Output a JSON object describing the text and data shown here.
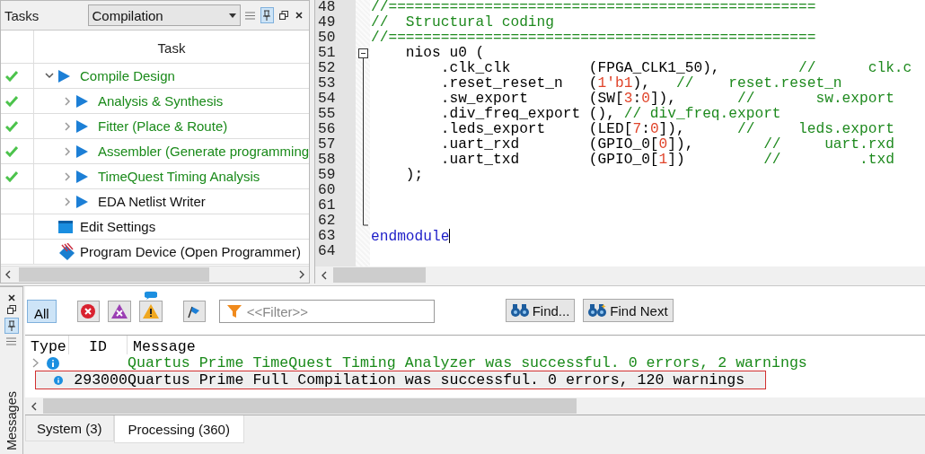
{
  "tasks_panel": {
    "title": "Tasks",
    "flow": "Compilation",
    "column_header": "Task",
    "items": [
      {
        "label": "Compile Design",
        "kind": "run",
        "done": true,
        "expanded": true,
        "children": [
          {
            "label": "Analysis & Synthesis",
            "kind": "run",
            "done": true,
            "expanded": false
          },
          {
            "label": "Fitter (Place & Route)",
            "kind": "run",
            "done": true,
            "expanded": false
          },
          {
            "label": "Assembler (Generate programming",
            "kind": "run",
            "done": true,
            "expanded": false
          },
          {
            "label": "TimeQuest Timing Analysis",
            "kind": "run",
            "done": true,
            "expanded": false
          },
          {
            "label": "EDA Netlist Writer",
            "kind": "run",
            "done": false,
            "expanded": false
          }
        ]
      },
      {
        "label": "Edit Settings",
        "kind": "settings",
        "done": false
      },
      {
        "label": "Program Device (Open Programmer)",
        "kind": "program",
        "done": false
      }
    ]
  },
  "editor": {
    "lines": [
      {
        "number": "48",
        "segments": [
          {
            "kind": "comment",
            "text": "//================================================="
          }
        ]
      },
      {
        "number": "49",
        "segments": [
          {
            "kind": "comment",
            "text": "//  Structural coding"
          }
        ]
      },
      {
        "number": "50",
        "segments": [
          {
            "kind": "comment",
            "text": "//================================================="
          }
        ]
      },
      {
        "number": "51",
        "expanded": true,
        "segments": [
          {
            "kind": "code",
            "text": "    nios u0 ("
          }
        ],
        "children": [
          {
            "number": "52",
            "segments": [
              {
                "kind": "code",
                "text": "        .clk_clk         (FPGA_CLK1_50),         "
              },
              {
                "kind": "comment",
                "text": "//      clk.c"
              }
            ]
          },
          {
            "number": "53",
            "segments": [
              {
                "kind": "code",
                "text": "        .reset_reset_n   ("
              },
              {
                "kind": "number",
                "text": "1'b1"
              },
              {
                "kind": "code",
                "text": "),   "
              },
              {
                "kind": "comment",
                "text": "//    reset.reset_n"
              }
            ]
          },
          {
            "number": "54",
            "segments": [
              {
                "kind": "code",
                "text": "        .sw_export       (SW["
              },
              {
                "kind": "number",
                "text": "3"
              },
              {
                "kind": "code",
                "text": ":"
              },
              {
                "kind": "number",
                "text": "0"
              },
              {
                "kind": "code",
                "text": "]),       "
              },
              {
                "kind": "comment",
                "text": "//       sw.export"
              }
            ]
          },
          {
            "number": "55",
            "segments": [
              {
                "kind": "code",
                "text": "        .div_freq_export (), "
              },
              {
                "kind": "comment",
                "text": "// div_freq.export"
              }
            ]
          },
          {
            "number": "56",
            "segments": [
              {
                "kind": "code",
                "text": "        .leds_export     (LED["
              },
              {
                "kind": "number",
                "text": "7"
              },
              {
                "kind": "code",
                "text": ":"
              },
              {
                "kind": "number",
                "text": "0"
              },
              {
                "kind": "code",
                "text": "]),      "
              },
              {
                "kind": "comment",
                "text": "//     leds.export"
              }
            ]
          },
          {
            "number": "57",
            "segments": [
              {
                "kind": "code",
                "text": "        .uart_rxd        (GPIO_0["
              },
              {
                "kind": "number",
                "text": "0"
              },
              {
                "kind": "code",
                "text": "]),        "
              },
              {
                "kind": "comment",
                "text": "//     uart.rxd"
              }
            ]
          },
          {
            "number": "58",
            "segments": [
              {
                "kind": "code",
                "text": "        .uart_txd        (GPIO_0["
              },
              {
                "kind": "number",
                "text": "1"
              },
              {
                "kind": "code",
                "text": "])         "
              },
              {
                "kind": "comment",
                "text": "//         .txd"
              }
            ]
          },
          {
            "number": "59",
            "segments": [
              {
                "kind": "code",
                "text": "    );"
              }
            ]
          },
          {
            "number": "60"
          },
          {
            "number": "61"
          },
          {
            "number": "62"
          }
        ]
      },
      {
        "number": "63",
        "cursor": true,
        "segments": [
          {
            "kind": "keyword",
            "text": "endmodule"
          }
        ]
      },
      {
        "number": "64"
      }
    ]
  },
  "messages_panel": {
    "title": "Messages",
    "filters": [
      {
        "kind": "all",
        "label": "All",
        "selected": true
      },
      {
        "kind": "error",
        "selected": false
      },
      {
        "kind": "critical",
        "selected": false
      },
      {
        "kind": "warning",
        "selected": false,
        "badge": true
      },
      {
        "kind": "flag",
        "selected": false
      }
    ],
    "filter_placeholder": "<<Filter>>",
    "buttons": [
      {
        "kind": "find",
        "label": "Find..."
      },
      {
        "kind": "find-next",
        "label": "Find Next"
      }
    ],
    "columns": [
      "Type",
      "ID",
      "Message"
    ],
    "rows": [
      {
        "expandable": true,
        "message": "Quartus Prime TimeQuest Timing Analyzer was successful. 0 errors, 2 warnings",
        "color": "#1a8a1a",
        "selected": false
      },
      {
        "expandable": false,
        "id": "293000",
        "message": "Quartus Prime Full Compilation was successful. 0 errors, 120 warnings",
        "color": "#000000",
        "selected": true
      }
    ],
    "tabs": [
      {
        "label": "System (3)",
        "selected": false
      },
      {
        "label": "Processing (360)",
        "selected": true
      }
    ]
  }
}
